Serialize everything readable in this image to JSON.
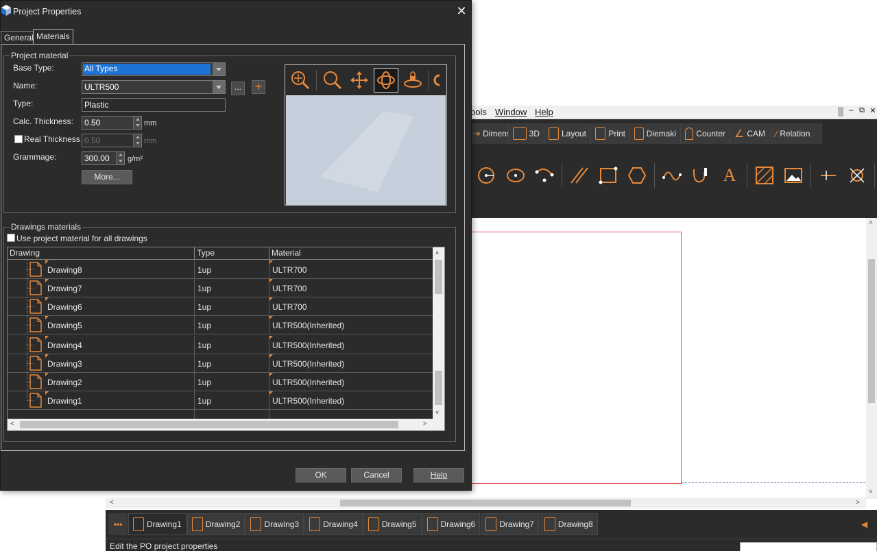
{
  "app": {
    "menu": [
      "ools",
      "Window",
      "Help"
    ],
    "ribbon_tabs": [
      "Dimensi",
      "3D",
      "Layout",
      "Print",
      "Diemaki",
      "Counter",
      "CAM",
      "Relation"
    ],
    "drawing_tabs": [
      "Drawing1",
      "Drawing2",
      "Drawing3",
      "Drawing4",
      "Drawing5",
      "Drawing6",
      "Drawing7",
      "Drawing8"
    ],
    "active_drawing": "Drawing1",
    "more_tabs": "•••",
    "status_text": "Edit the PO project properties"
  },
  "dialog": {
    "title": "Project Properties",
    "close": "✕",
    "tabs": [
      "General",
      "Materials"
    ],
    "active_tab": "Materials",
    "project_material": {
      "legend": "Project material",
      "base_type_label": "Base Type:",
      "base_type_value": "All Types",
      "name_label": "Name:",
      "name_value": "ULTR500",
      "name_browse": "...",
      "name_add": "+",
      "type_label": "Type:",
      "type_value": "Plastic",
      "calc_thickness_label": "Calc. Thickness:",
      "calc_thickness_value": "0.50",
      "calc_thickness_unit": "mm",
      "real_thickness_label": "Real Thickness",
      "real_thickness_value": "0.50",
      "real_thickness_unit": "mm",
      "gramage_label": "Grammage:",
      "gramage_value": "300.00",
      "gramage_unit": "g/m²",
      "more_button": "More..."
    },
    "drawings_materials": {
      "legend": "Drawings materials",
      "use_project_label": "Use project material for all drawings",
      "columns": [
        "Drawing",
        "Type",
        "Material"
      ],
      "rows": [
        {
          "drawing": "Drawing8",
          "type": "1up",
          "material": "ULTR700"
        },
        {
          "drawing": "Drawing7",
          "type": "1up",
          "material": "ULTR700"
        },
        {
          "drawing": "Drawing6",
          "type": "1up",
          "material": "ULTR700"
        },
        {
          "drawing": "Drawing5",
          "type": "1up",
          "material": "ULTR500(Inherited)"
        },
        {
          "drawing": "Drawing4",
          "type": "1up",
          "material": "ULTR500(Inherited)"
        },
        {
          "drawing": "Drawing3",
          "type": "1up",
          "material": "ULTR500(Inherited)"
        },
        {
          "drawing": "Drawing2",
          "type": "1up",
          "material": "ULTR500(Inherited)"
        },
        {
          "drawing": "Drawing1",
          "type": "1up",
          "material": "ULTR500(Inherited)"
        }
      ]
    },
    "buttons": {
      "ok": "OK",
      "cancel": "Cancel",
      "help": "Help"
    }
  },
  "colors": {
    "accent": "#e8893a",
    "dialog_bg": "#2b2b2b",
    "selection": "#1e73d6",
    "canvas_outline": "#e0555a"
  }
}
